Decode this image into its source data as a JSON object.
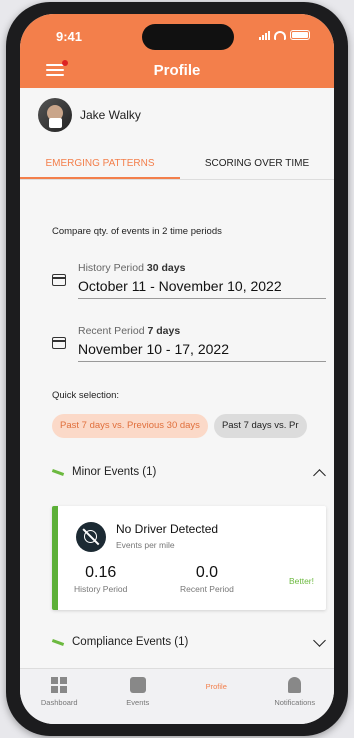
{
  "status_bar": {
    "time": "9:41"
  },
  "header": {
    "title": "Profile"
  },
  "user": {
    "name": "Jake Walky"
  },
  "tabs": [
    {
      "label": "EMERGING PATTERNS",
      "active": true
    },
    {
      "label": "SCORING OVER TIME",
      "active": false
    }
  ],
  "compare_text": "Compare qty. of events in 2 time periods",
  "history_period": {
    "label": "History Period",
    "days": "30 days",
    "value": "October 11 - November 10, 2022"
  },
  "recent_period": {
    "label": "Recent Period",
    "days": "7 days",
    "value": "November 10 - 17, 2022"
  },
  "quick_selection": {
    "label": "Quick selection:",
    "chips": [
      "Past 7 days vs. Previous 30 days",
      "Past 7 days vs. Pr"
    ]
  },
  "sections": {
    "minor": {
      "label": "Minor Events (1)",
      "expanded": true
    },
    "compliance": {
      "label": "Compliance Events (1)",
      "expanded": false
    }
  },
  "event_card": {
    "title": "No Driver Detected",
    "subtitle": "Events per mile",
    "history_value": "0.16",
    "history_caption": "History Period",
    "recent_value": "0.0",
    "recent_caption": "Recent Period",
    "status": "Better!"
  },
  "bottom_nav": [
    {
      "label": "Dashboard",
      "icon": "dashboard-icon"
    },
    {
      "label": "Events",
      "icon": "events-icon"
    },
    {
      "label": "Profile",
      "icon": "profile-icon",
      "active": true
    },
    {
      "label": "Notifications",
      "icon": "bell-icon"
    }
  ],
  "colors": {
    "accent": "#f37f4b",
    "success": "#5cb037",
    "chip_bg": "#fbd9c8"
  }
}
